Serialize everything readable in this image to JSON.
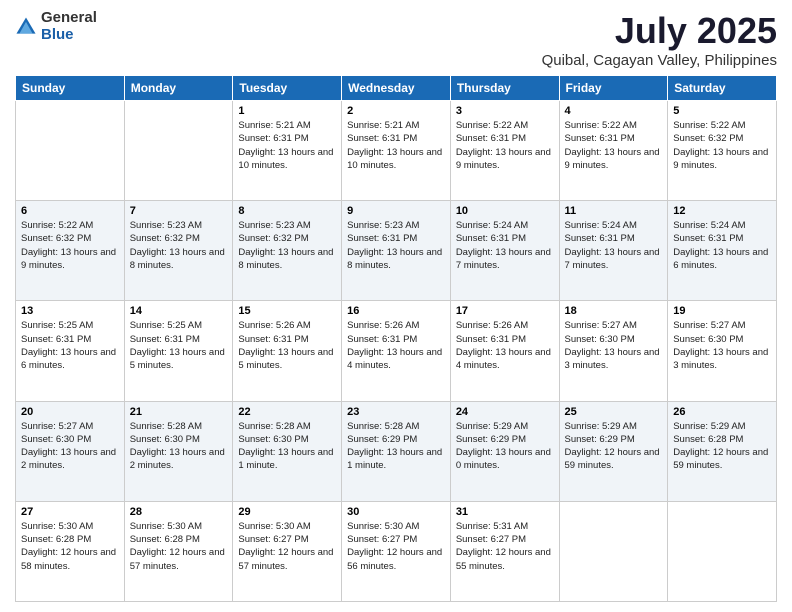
{
  "logo": {
    "general": "General",
    "blue": "Blue"
  },
  "title": "July 2025",
  "subtitle": "Quibal, Cagayan Valley, Philippines",
  "weekdays": [
    "Sunday",
    "Monday",
    "Tuesday",
    "Wednesday",
    "Thursday",
    "Friday",
    "Saturday"
  ],
  "weeks": [
    [
      {
        "day": "",
        "info": ""
      },
      {
        "day": "",
        "info": ""
      },
      {
        "day": "1",
        "info": "Sunrise: 5:21 AM\nSunset: 6:31 PM\nDaylight: 13 hours\nand 10 minutes."
      },
      {
        "day": "2",
        "info": "Sunrise: 5:21 AM\nSunset: 6:31 PM\nDaylight: 13 hours\nand 10 minutes."
      },
      {
        "day": "3",
        "info": "Sunrise: 5:22 AM\nSunset: 6:31 PM\nDaylight: 13 hours\nand 9 minutes."
      },
      {
        "day": "4",
        "info": "Sunrise: 5:22 AM\nSunset: 6:31 PM\nDaylight: 13 hours\nand 9 minutes."
      },
      {
        "day": "5",
        "info": "Sunrise: 5:22 AM\nSunset: 6:32 PM\nDaylight: 13 hours\nand 9 minutes."
      }
    ],
    [
      {
        "day": "6",
        "info": "Sunrise: 5:22 AM\nSunset: 6:32 PM\nDaylight: 13 hours\nand 9 minutes."
      },
      {
        "day": "7",
        "info": "Sunrise: 5:23 AM\nSunset: 6:32 PM\nDaylight: 13 hours\nand 8 minutes."
      },
      {
        "day": "8",
        "info": "Sunrise: 5:23 AM\nSunset: 6:32 PM\nDaylight: 13 hours\nand 8 minutes."
      },
      {
        "day": "9",
        "info": "Sunrise: 5:23 AM\nSunset: 6:31 PM\nDaylight: 13 hours\nand 8 minutes."
      },
      {
        "day": "10",
        "info": "Sunrise: 5:24 AM\nSunset: 6:31 PM\nDaylight: 13 hours\nand 7 minutes."
      },
      {
        "day": "11",
        "info": "Sunrise: 5:24 AM\nSunset: 6:31 PM\nDaylight: 13 hours\nand 7 minutes."
      },
      {
        "day": "12",
        "info": "Sunrise: 5:24 AM\nSunset: 6:31 PM\nDaylight: 13 hours\nand 6 minutes."
      }
    ],
    [
      {
        "day": "13",
        "info": "Sunrise: 5:25 AM\nSunset: 6:31 PM\nDaylight: 13 hours\nand 6 minutes."
      },
      {
        "day": "14",
        "info": "Sunrise: 5:25 AM\nSunset: 6:31 PM\nDaylight: 13 hours\nand 5 minutes."
      },
      {
        "day": "15",
        "info": "Sunrise: 5:26 AM\nSunset: 6:31 PM\nDaylight: 13 hours\nand 5 minutes."
      },
      {
        "day": "16",
        "info": "Sunrise: 5:26 AM\nSunset: 6:31 PM\nDaylight: 13 hours\nand 4 minutes."
      },
      {
        "day": "17",
        "info": "Sunrise: 5:26 AM\nSunset: 6:31 PM\nDaylight: 13 hours\nand 4 minutes."
      },
      {
        "day": "18",
        "info": "Sunrise: 5:27 AM\nSunset: 6:30 PM\nDaylight: 13 hours\nand 3 minutes."
      },
      {
        "day": "19",
        "info": "Sunrise: 5:27 AM\nSunset: 6:30 PM\nDaylight: 13 hours\nand 3 minutes."
      }
    ],
    [
      {
        "day": "20",
        "info": "Sunrise: 5:27 AM\nSunset: 6:30 PM\nDaylight: 13 hours\nand 2 minutes."
      },
      {
        "day": "21",
        "info": "Sunrise: 5:28 AM\nSunset: 6:30 PM\nDaylight: 13 hours\nand 2 minutes."
      },
      {
        "day": "22",
        "info": "Sunrise: 5:28 AM\nSunset: 6:30 PM\nDaylight: 13 hours\nand 1 minute."
      },
      {
        "day": "23",
        "info": "Sunrise: 5:28 AM\nSunset: 6:29 PM\nDaylight: 13 hours\nand 1 minute."
      },
      {
        "day": "24",
        "info": "Sunrise: 5:29 AM\nSunset: 6:29 PM\nDaylight: 13 hours\nand 0 minutes."
      },
      {
        "day": "25",
        "info": "Sunrise: 5:29 AM\nSunset: 6:29 PM\nDaylight: 12 hours\nand 59 minutes."
      },
      {
        "day": "26",
        "info": "Sunrise: 5:29 AM\nSunset: 6:28 PM\nDaylight: 12 hours\nand 59 minutes."
      }
    ],
    [
      {
        "day": "27",
        "info": "Sunrise: 5:30 AM\nSunset: 6:28 PM\nDaylight: 12 hours\nand 58 minutes."
      },
      {
        "day": "28",
        "info": "Sunrise: 5:30 AM\nSunset: 6:28 PM\nDaylight: 12 hours\nand 57 minutes."
      },
      {
        "day": "29",
        "info": "Sunrise: 5:30 AM\nSunset: 6:27 PM\nDaylight: 12 hours\nand 57 minutes."
      },
      {
        "day": "30",
        "info": "Sunrise: 5:30 AM\nSunset: 6:27 PM\nDaylight: 12 hours\nand 56 minutes."
      },
      {
        "day": "31",
        "info": "Sunrise: 5:31 AM\nSunset: 6:27 PM\nDaylight: 12 hours\nand 55 minutes."
      },
      {
        "day": "",
        "info": ""
      },
      {
        "day": "",
        "info": ""
      }
    ]
  ]
}
